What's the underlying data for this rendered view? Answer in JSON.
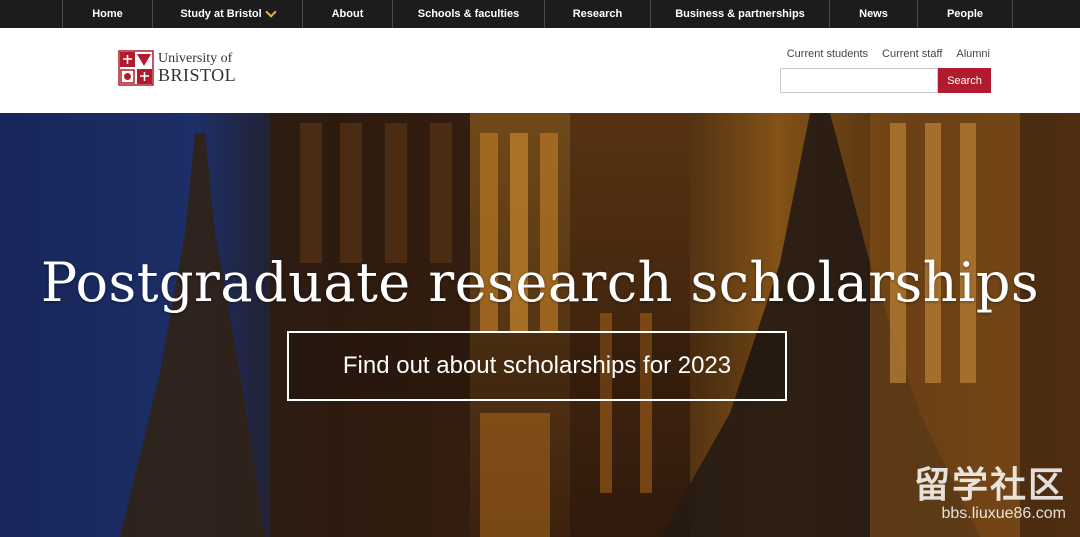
{
  "topnav": {
    "items": [
      {
        "label": "Home",
        "has_chevron": false
      },
      {
        "label": "Study at Bristol",
        "has_chevron": true
      },
      {
        "label": "About",
        "has_chevron": false
      },
      {
        "label": "Schools & faculties",
        "has_chevron": false
      },
      {
        "label": "Research",
        "has_chevron": false
      },
      {
        "label": "Business & partnerships",
        "has_chevron": false
      },
      {
        "label": "News",
        "has_chevron": false
      },
      {
        "label": "People",
        "has_chevron": false
      }
    ]
  },
  "header": {
    "logo_line1": "University of",
    "logo_line2": "BRISTOL",
    "util_links": [
      "Current students",
      "Current staff",
      "Alumni"
    ],
    "search_placeholder": "",
    "search_button": "Search",
    "brand_color": "#b01c2e"
  },
  "hero": {
    "title": "Postgraduate research scholarships",
    "cta": "Find out about scholarships for 2023"
  },
  "watermark": {
    "big": "留学社区",
    "small": "bbs.liuxue86.com"
  }
}
